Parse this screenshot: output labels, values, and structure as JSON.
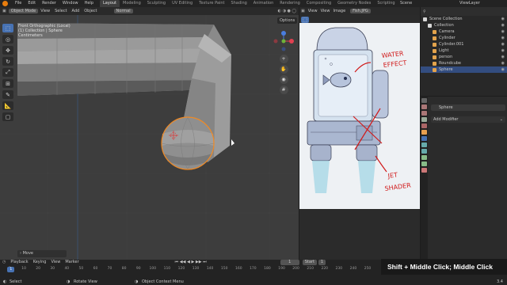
{
  "menu": [
    "File",
    "Edit",
    "Render",
    "Window",
    "Help"
  ],
  "workspace_tabs": [
    "Layout",
    "Modeling",
    "Sculpting",
    "UV Editing",
    "Texture Paint",
    "Shading",
    "Animation",
    "Rendering",
    "Compositing",
    "Geometry Nodes",
    "Scripting"
  ],
  "active_tab_index": 0,
  "scene": "Scene",
  "view_layer": "ViewLayer",
  "viewport": {
    "mode": "Object Mode",
    "menus": [
      "View",
      "Select",
      "Add",
      "Object"
    ],
    "orientation": "Normal",
    "info_lines": [
      "Front Orthographic (Local)",
      "(1) Collection | Sphere",
      "Centimeters"
    ],
    "options_label": "Options",
    "last_op": "Move"
  },
  "image_editor": {
    "menus": [
      "View",
      "View",
      "Image"
    ],
    "image_name": "Fish.JPG",
    "annotations": [
      "WATER",
      "EFFECT",
      "JET",
      "SHADER"
    ]
  },
  "outliner": {
    "title": "Scene Collection",
    "items": [
      {
        "name": "Scene Collection",
        "indent": 0,
        "color": "#d8d8d8"
      },
      {
        "name": "Collection",
        "indent": 1,
        "color": "#d8d8d8"
      },
      {
        "name": "Camera",
        "indent": 2,
        "color": "#e3a34c"
      },
      {
        "name": "Cylinder",
        "indent": 2,
        "color": "#e3a34c"
      },
      {
        "name": "Cylinder.001",
        "indent": 2,
        "color": "#e3a34c"
      },
      {
        "name": "Light",
        "indent": 2,
        "color": "#e3a34c"
      },
      {
        "name": "person",
        "indent": 2,
        "color": "#e3a34c"
      },
      {
        "name": "Roundcube",
        "indent": 2,
        "color": "#e3a34c"
      },
      {
        "name": "Sphere",
        "indent": 2,
        "color": "#e3a34c",
        "selected": true
      }
    ]
  },
  "properties": {
    "object_name": "Sphere",
    "add_modifier": "Add Modifier"
  },
  "timeline": {
    "menus": [
      "Playback",
      "Keying",
      "View",
      "Marker"
    ],
    "current_frame": "1",
    "start_label": "Start",
    "start_value": "1",
    "ticks": [
      "0",
      "10",
      "20",
      "30",
      "40",
      "50",
      "60",
      "70",
      "80",
      "90",
      "100",
      "110",
      "120",
      "130",
      "140",
      "150",
      "160",
      "170",
      "180",
      "190",
      "200",
      "210",
      "220",
      "230",
      "240",
      "250"
    ]
  },
  "status": {
    "select": "Select",
    "rotate": "Rotate View",
    "context": "Object Context Menu",
    "version": "3.4"
  },
  "shortcut_overlay": "Shift + Middle Click; Middle Click",
  "colors": {
    "accent": "#4772b3",
    "selection_outline": "#f08a24",
    "annotation_red": "#d11a1a"
  }
}
